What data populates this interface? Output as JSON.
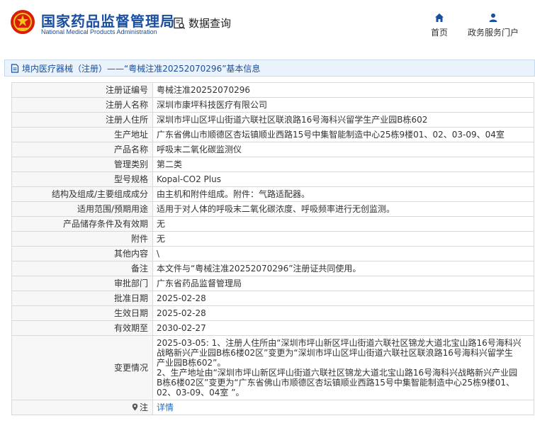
{
  "header": {
    "site_name_cn": "国家药品监督管理局",
    "site_name_en": "National Medical Products Administration",
    "query_label": "数据查询",
    "nav": [
      {
        "label": "首页",
        "icon": "home-icon"
      },
      {
        "label": "政务服务门户",
        "icon": "user-icon"
      }
    ]
  },
  "breadcrumb": "境内医疗器械（注册）——“粤械注准20252070296”基本信息",
  "colors": {
    "brand_blue": "#1a4fa0",
    "link_blue": "#1a6fc9",
    "emblem_red": "#d81e06"
  },
  "rows": [
    {
      "label": "注册证编号",
      "value": "粤械注准20252070296"
    },
    {
      "label": "注册人名称",
      "value": "深圳市康坪科技医疗有限公司"
    },
    {
      "label": "注册人住所",
      "value": "深圳市坪山区坪山街道六联社区联浪路16号海科兴留学生产业园B栋602"
    },
    {
      "label": "生产地址",
      "value": "广东省佛山市顺德区杏坛镇顺业西路15号中集智能制造中心25栋9楼01、02、03-09、04室"
    },
    {
      "label": "产品名称",
      "value": "呼吸末二氧化碳监测仪"
    },
    {
      "label": "管理类别",
      "value": "第二类"
    },
    {
      "label": "型号规格",
      "value": "Kopal-CO2 Plus"
    },
    {
      "label": "结构及组成/主要组成成分",
      "value": "由主机和附件组成。附件：气路适配器。"
    },
    {
      "label": "适用范围/预期用途",
      "value": "适用于对人体的呼吸末二氧化碳浓度、呼吸频率进行无创监测。"
    },
    {
      "label": "产品储存条件及有效期",
      "value": "无"
    },
    {
      "label": "附件",
      "value": "无"
    },
    {
      "label": "其他内容",
      "value": "\\"
    },
    {
      "label": "备注",
      "value": "本文件与“粤械注准20252070296”注册证共同使用。"
    },
    {
      "label": "审批部门",
      "value": "广东省药品监督管理局"
    },
    {
      "label": "批准日期",
      "value": "2025-02-28"
    },
    {
      "label": "生效日期",
      "value": "2025-02-28"
    },
    {
      "label": "有效期至",
      "value": "2030-02-27"
    }
  ],
  "change": {
    "label": "变更情况",
    "lines": [
      "2025-03-05: 1、注册人住所由“深圳市坪山新区坪山街道六联社区锦龙大道北宝山路16号海科兴",
      "战略新兴产业园B栋6楼02区”变更为“深圳市坪山区坪山街道六联社区联浪路16号海科兴留学生",
      "产业园B栋602”。",
      "2、生产地址由“深圳市坪山新区坪山街道六联社区锦龙大道北宝山路16号海科兴战略新兴产业园",
      "B栋6楼02区”变更为“广东省佛山市顺德区杏坛镇顺业西路15号中集智能制造中心25栋9楼01、",
      "02、03-09、04室 ”。"
    ]
  },
  "note": {
    "label": "注",
    "link": "详情"
  }
}
